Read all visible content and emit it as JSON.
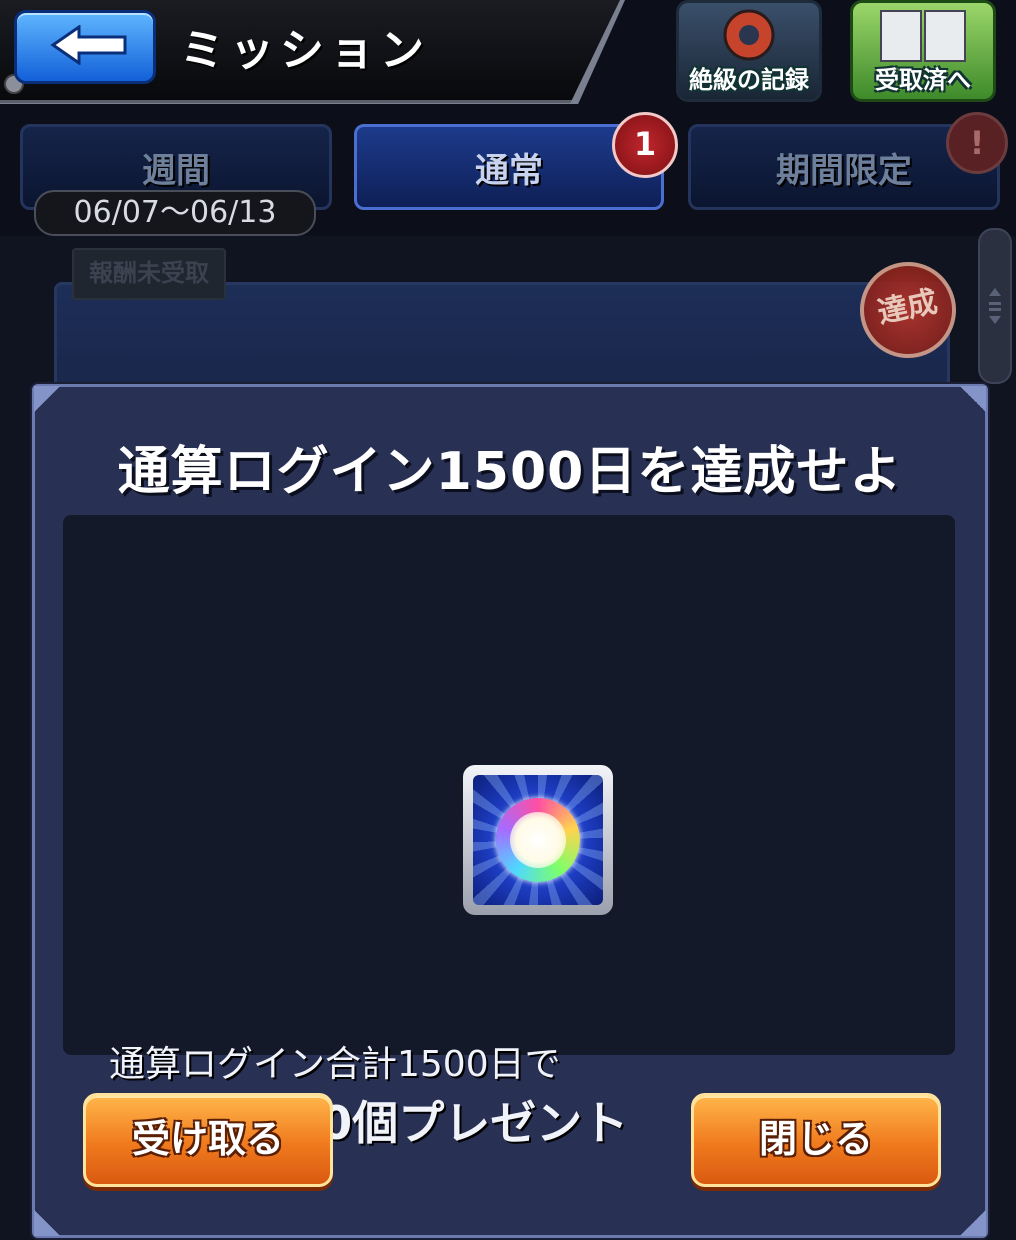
{
  "header": {
    "title": "ミッション",
    "back_icon": "back-arrow-icon",
    "record_label": "絶級の記録",
    "received_label": "受取済へ"
  },
  "tabs": [
    {
      "label": "週間",
      "active": false
    },
    {
      "label": "通常",
      "active": true,
      "badge": "1"
    },
    {
      "label": "期間限定",
      "active": false,
      "badge": "!"
    }
  ],
  "weekly_period": "06/07〜06/13",
  "background": {
    "unreceived_label": "報酬未受取",
    "achieved_stamp": "達成"
  },
  "dialog": {
    "title": "通算ログイン1500日を達成せよ",
    "reward_icon": "orb-icon",
    "description_line1": "通算ログイン合計1500日で",
    "description_line2": "オーブを20個プレゼント",
    "receive_button": "受け取る",
    "close_button": "閉じる"
  },
  "colors": {
    "dialog_bg": "#283154",
    "button_orange": "#f07a1e",
    "badge_red": "#c0262c",
    "back_button_blue": "#1360d8"
  }
}
